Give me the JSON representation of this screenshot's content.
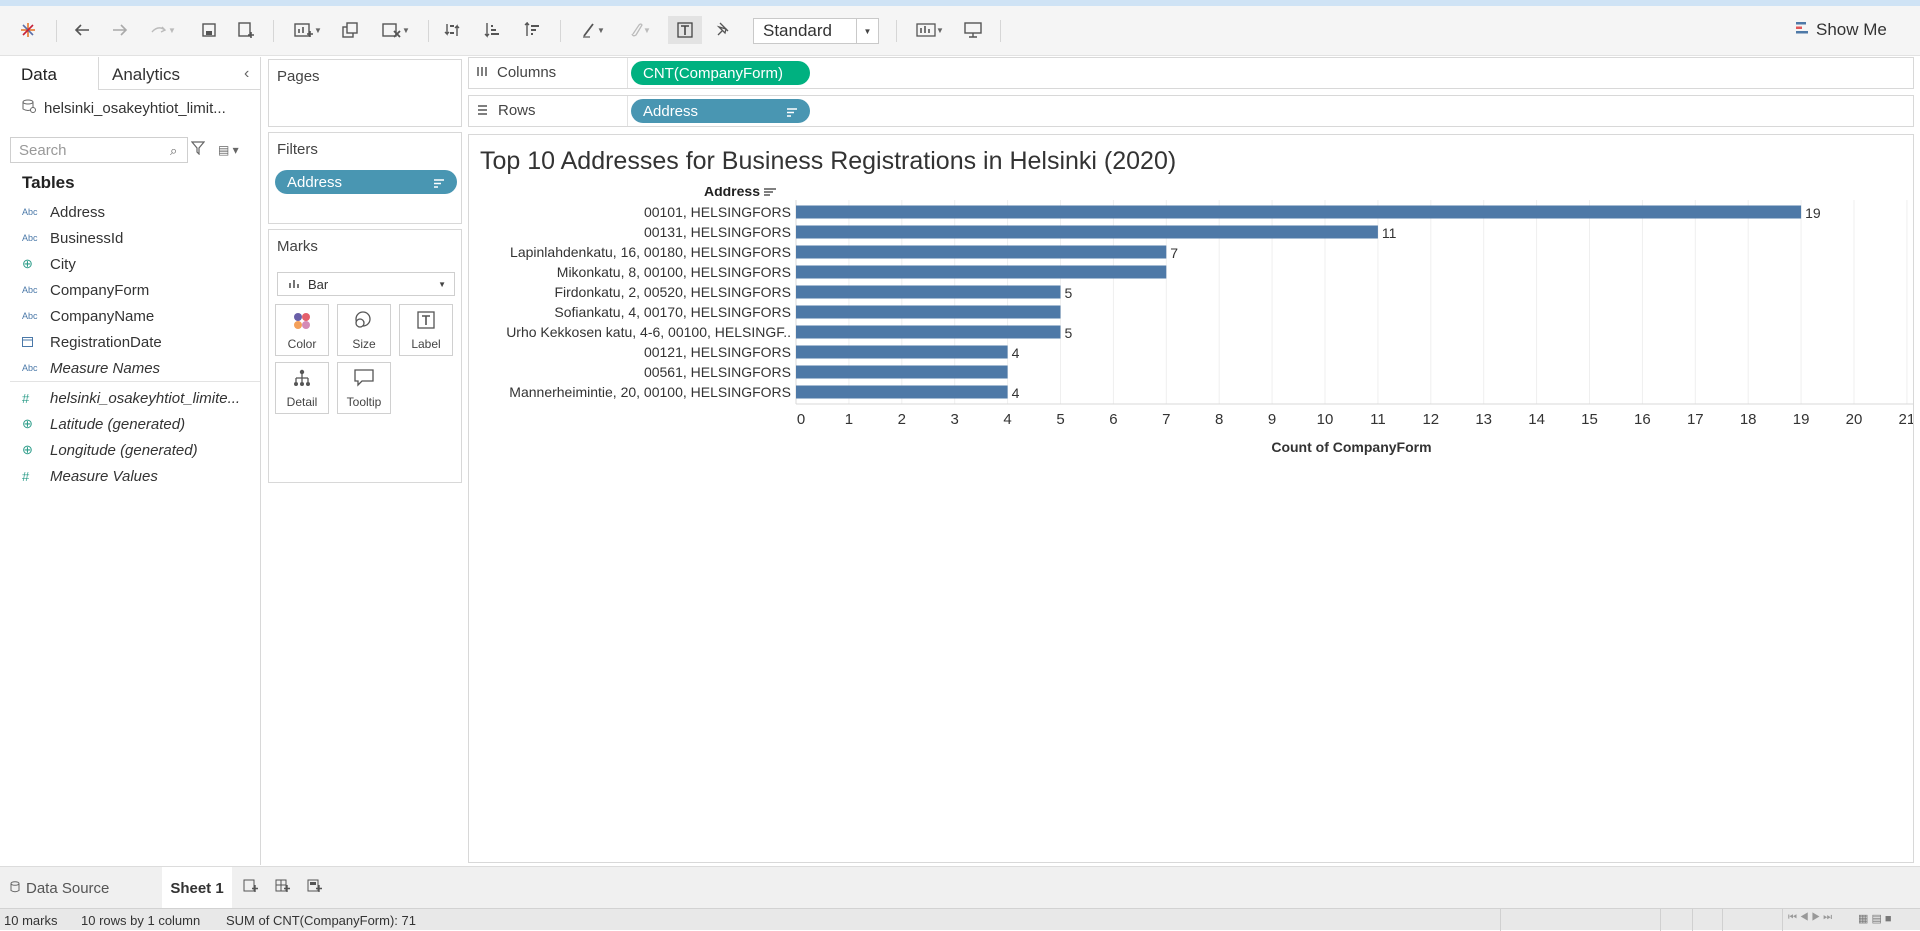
{
  "toolbar": {
    "standard_label": "Standard",
    "show_me_label": "Show Me",
    "icons": [
      "tableau-logo-icon",
      "undo-icon",
      "redo-icon",
      "replay-icon",
      "save-icon",
      "new-datasource-icon",
      "new-worksheet-icon",
      "duplicate-icon",
      "clear-sheet-icon",
      "swap-icon",
      "sort-asc-icon",
      "sort-desc-icon",
      "highlight-icon",
      "group-icon",
      "show-labels-icon",
      "pin-icon",
      "fit-icon",
      "presentation-icon"
    ]
  },
  "data_pane": {
    "tab_data": "Data",
    "tab_analytics": "Analytics",
    "datasource": "helsinki_osakeyhtiot_limit...",
    "search_placeholder": "Search",
    "tables_heading": "Tables",
    "fields": [
      {
        "type": "Abc",
        "name": "Address"
      },
      {
        "type": "Abc",
        "name": "BusinessId"
      },
      {
        "type": "geo",
        "name": "City"
      },
      {
        "type": "Abc",
        "name": "CompanyForm"
      },
      {
        "type": "Abc",
        "name": "CompanyName"
      },
      {
        "type": "date",
        "name": "RegistrationDate"
      },
      {
        "type": "Abc",
        "name": "Measure Names"
      },
      {
        "type": "#",
        "name": "helsinki_osakeyhtiot_limite..."
      },
      {
        "type": "geo",
        "name": "Latitude (generated)"
      },
      {
        "type": "geo",
        "name": "Longitude (generated)"
      },
      {
        "type": "#",
        "name": "Measure Values"
      }
    ]
  },
  "cards": {
    "pages": "Pages",
    "filters": "Filters",
    "filter_pill": "Address",
    "marks": "Marks",
    "mark_type": "Bar",
    "buttons": [
      "Color",
      "Size",
      "Label",
      "Detail",
      "Tooltip"
    ]
  },
  "shelves": {
    "columns_label": "Columns",
    "columns_pill": "CNT(CompanyForm)",
    "rows_label": "Rows",
    "rows_pill": "Address"
  },
  "viz": {
    "title": "Top 10 Addresses for Business Registrations in Helsinki (2020)",
    "row_header": "Address"
  },
  "chart_data": {
    "type": "bar",
    "orientation": "horizontal",
    "title": "Top 10 Addresses for Business Registrations in Helsinki (2020)",
    "xlabel": "Count of CompanyForm",
    "ylabel": "Address",
    "xlim": [
      0,
      21
    ],
    "xticks": [
      0,
      1,
      2,
      3,
      4,
      5,
      6,
      7,
      8,
      9,
      10,
      11,
      12,
      13,
      14,
      15,
      16,
      17,
      18,
      19,
      20,
      21
    ],
    "bar_color": "#4e79a7",
    "categories": [
      "00101, HELSINGFORS",
      "00131, HELSINGFORS",
      "Lapinlahdenkatu, 16, 00180, HELSINGFORS",
      "Mikonkatu, 8, 00100, HELSINGFORS",
      "Firdonkatu, 2, 00520, HELSINGFORS",
      "Sofiankatu, 4, 00170, HELSINGFORS",
      "Urho Kekkosen katu, 4-6, 00100, HELSINGF..",
      "00121, HELSINGFORS",
      "00561, HELSINGFORS",
      "Mannerheimintie, 20, 00100, HELSINGFORS"
    ],
    "values": [
      19,
      11,
      7,
      7,
      5,
      5,
      5,
      4,
      4,
      4
    ],
    "data_labels": [
      "19",
      "11",
      "7",
      "",
      "5",
      "",
      "5",
      "4",
      "",
      "4"
    ]
  },
  "bottom": {
    "datasource_tab": "Data Source",
    "sheet_tab": "Sheet 1"
  },
  "status": {
    "marks": "10 marks",
    "rows": "10 rows by 1 column",
    "sum": "SUM of CNT(CompanyForm): 71"
  }
}
